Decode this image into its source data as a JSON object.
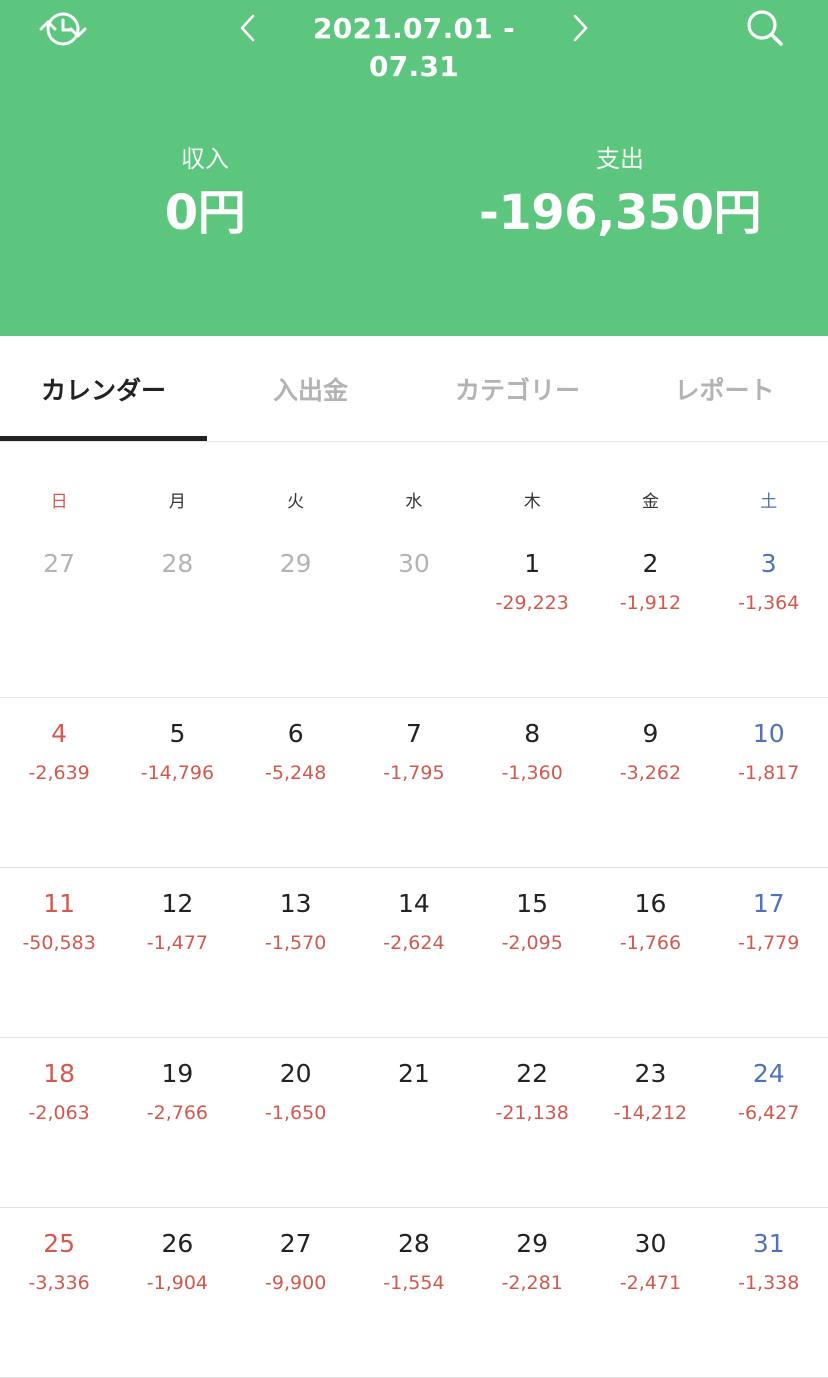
{
  "header": {
    "history_icon": "clock-refresh-icon",
    "search_icon": "search-icon",
    "prev_icon": "chevron-left-icon",
    "next_icon": "chevron-right-icon",
    "period": "2021.07.01 - 07.31",
    "income_label": "収入",
    "income_value": "0円",
    "expense_label": "支出",
    "expense_value": "-196,350円",
    "bg_color": "#5cc57e"
  },
  "tabs": [
    {
      "label": "カレンダー",
      "active": true
    },
    {
      "label": "入出金",
      "active": false
    },
    {
      "label": "カテゴリー",
      "active": false
    },
    {
      "label": "レポート",
      "active": false
    }
  ],
  "weekdays": [
    "日",
    "月",
    "火",
    "水",
    "木",
    "金",
    "土"
  ],
  "weeks": [
    [
      {
        "day": "27",
        "amount": "",
        "other": true
      },
      {
        "day": "28",
        "amount": "",
        "other": true
      },
      {
        "day": "29",
        "amount": "",
        "other": true
      },
      {
        "day": "30",
        "amount": "",
        "other": true
      },
      {
        "day": "1",
        "amount": "-29,223"
      },
      {
        "day": "2",
        "amount": "-1,912"
      },
      {
        "day": "3",
        "amount": "-1,364"
      }
    ],
    [
      {
        "day": "4",
        "amount": "-2,639"
      },
      {
        "day": "5",
        "amount": "-14,796"
      },
      {
        "day": "6",
        "amount": "-5,248"
      },
      {
        "day": "7",
        "amount": "-1,795"
      },
      {
        "day": "8",
        "amount": "-1,360"
      },
      {
        "day": "9",
        "amount": "-3,262"
      },
      {
        "day": "10",
        "amount": "-1,817"
      }
    ],
    [
      {
        "day": "11",
        "amount": "-50,583"
      },
      {
        "day": "12",
        "amount": "-1,477"
      },
      {
        "day": "13",
        "amount": "-1,570"
      },
      {
        "day": "14",
        "amount": "-2,624"
      },
      {
        "day": "15",
        "amount": "-2,095"
      },
      {
        "day": "16",
        "amount": "-1,766"
      },
      {
        "day": "17",
        "amount": "-1,779"
      }
    ],
    [
      {
        "day": "18",
        "amount": "-2,063"
      },
      {
        "day": "19",
        "amount": "-2,766"
      },
      {
        "day": "20",
        "amount": "-1,650"
      },
      {
        "day": "21",
        "amount": ""
      },
      {
        "day": "22",
        "amount": "-21,138"
      },
      {
        "day": "23",
        "amount": "-14,212"
      },
      {
        "day": "24",
        "amount": "-6,427"
      }
    ],
    [
      {
        "day": "25",
        "amount": "-3,336"
      },
      {
        "day": "26",
        "amount": "-1,904"
      },
      {
        "day": "27",
        "amount": "-9,900"
      },
      {
        "day": "28",
        "amount": "-1,554"
      },
      {
        "day": "29",
        "amount": "-2,281"
      },
      {
        "day": "30",
        "amount": "-2,471"
      },
      {
        "day": "31",
        "amount": "-1,338"
      }
    ]
  ],
  "colors": {
    "sunday": "#d5584f",
    "saturday": "#4e73b8",
    "expense": "#d2584e",
    "muted": "#b3b3b3"
  }
}
